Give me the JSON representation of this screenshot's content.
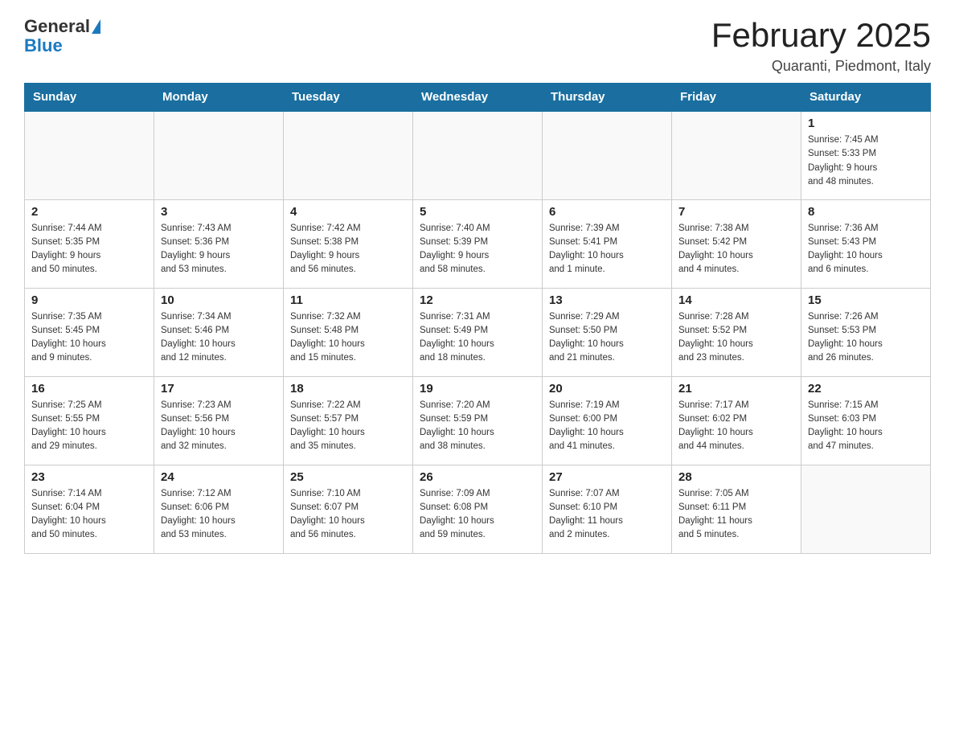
{
  "logo": {
    "general": "General",
    "blue": "Blue"
  },
  "title": "February 2025",
  "subtitle": "Quaranti, Piedmont, Italy",
  "weekdays": [
    "Sunday",
    "Monday",
    "Tuesday",
    "Wednesday",
    "Thursday",
    "Friday",
    "Saturday"
  ],
  "weeks": [
    [
      {
        "day": "",
        "info": ""
      },
      {
        "day": "",
        "info": ""
      },
      {
        "day": "",
        "info": ""
      },
      {
        "day": "",
        "info": ""
      },
      {
        "day": "",
        "info": ""
      },
      {
        "day": "",
        "info": ""
      },
      {
        "day": "1",
        "info": "Sunrise: 7:45 AM\nSunset: 5:33 PM\nDaylight: 9 hours\nand 48 minutes."
      }
    ],
    [
      {
        "day": "2",
        "info": "Sunrise: 7:44 AM\nSunset: 5:35 PM\nDaylight: 9 hours\nand 50 minutes."
      },
      {
        "day": "3",
        "info": "Sunrise: 7:43 AM\nSunset: 5:36 PM\nDaylight: 9 hours\nand 53 minutes."
      },
      {
        "day": "4",
        "info": "Sunrise: 7:42 AM\nSunset: 5:38 PM\nDaylight: 9 hours\nand 56 minutes."
      },
      {
        "day": "5",
        "info": "Sunrise: 7:40 AM\nSunset: 5:39 PM\nDaylight: 9 hours\nand 58 minutes."
      },
      {
        "day": "6",
        "info": "Sunrise: 7:39 AM\nSunset: 5:41 PM\nDaylight: 10 hours\nand 1 minute."
      },
      {
        "day": "7",
        "info": "Sunrise: 7:38 AM\nSunset: 5:42 PM\nDaylight: 10 hours\nand 4 minutes."
      },
      {
        "day": "8",
        "info": "Sunrise: 7:36 AM\nSunset: 5:43 PM\nDaylight: 10 hours\nand 6 minutes."
      }
    ],
    [
      {
        "day": "9",
        "info": "Sunrise: 7:35 AM\nSunset: 5:45 PM\nDaylight: 10 hours\nand 9 minutes."
      },
      {
        "day": "10",
        "info": "Sunrise: 7:34 AM\nSunset: 5:46 PM\nDaylight: 10 hours\nand 12 minutes."
      },
      {
        "day": "11",
        "info": "Sunrise: 7:32 AM\nSunset: 5:48 PM\nDaylight: 10 hours\nand 15 minutes."
      },
      {
        "day": "12",
        "info": "Sunrise: 7:31 AM\nSunset: 5:49 PM\nDaylight: 10 hours\nand 18 minutes."
      },
      {
        "day": "13",
        "info": "Sunrise: 7:29 AM\nSunset: 5:50 PM\nDaylight: 10 hours\nand 21 minutes."
      },
      {
        "day": "14",
        "info": "Sunrise: 7:28 AM\nSunset: 5:52 PM\nDaylight: 10 hours\nand 23 minutes."
      },
      {
        "day": "15",
        "info": "Sunrise: 7:26 AM\nSunset: 5:53 PM\nDaylight: 10 hours\nand 26 minutes."
      }
    ],
    [
      {
        "day": "16",
        "info": "Sunrise: 7:25 AM\nSunset: 5:55 PM\nDaylight: 10 hours\nand 29 minutes."
      },
      {
        "day": "17",
        "info": "Sunrise: 7:23 AM\nSunset: 5:56 PM\nDaylight: 10 hours\nand 32 minutes."
      },
      {
        "day": "18",
        "info": "Sunrise: 7:22 AM\nSunset: 5:57 PM\nDaylight: 10 hours\nand 35 minutes."
      },
      {
        "day": "19",
        "info": "Sunrise: 7:20 AM\nSunset: 5:59 PM\nDaylight: 10 hours\nand 38 minutes."
      },
      {
        "day": "20",
        "info": "Sunrise: 7:19 AM\nSunset: 6:00 PM\nDaylight: 10 hours\nand 41 minutes."
      },
      {
        "day": "21",
        "info": "Sunrise: 7:17 AM\nSunset: 6:02 PM\nDaylight: 10 hours\nand 44 minutes."
      },
      {
        "day": "22",
        "info": "Sunrise: 7:15 AM\nSunset: 6:03 PM\nDaylight: 10 hours\nand 47 minutes."
      }
    ],
    [
      {
        "day": "23",
        "info": "Sunrise: 7:14 AM\nSunset: 6:04 PM\nDaylight: 10 hours\nand 50 minutes."
      },
      {
        "day": "24",
        "info": "Sunrise: 7:12 AM\nSunset: 6:06 PM\nDaylight: 10 hours\nand 53 minutes."
      },
      {
        "day": "25",
        "info": "Sunrise: 7:10 AM\nSunset: 6:07 PM\nDaylight: 10 hours\nand 56 minutes."
      },
      {
        "day": "26",
        "info": "Sunrise: 7:09 AM\nSunset: 6:08 PM\nDaylight: 10 hours\nand 59 minutes."
      },
      {
        "day": "27",
        "info": "Sunrise: 7:07 AM\nSunset: 6:10 PM\nDaylight: 11 hours\nand 2 minutes."
      },
      {
        "day": "28",
        "info": "Sunrise: 7:05 AM\nSunset: 6:11 PM\nDaylight: 11 hours\nand 5 minutes."
      },
      {
        "day": "",
        "info": ""
      }
    ]
  ]
}
